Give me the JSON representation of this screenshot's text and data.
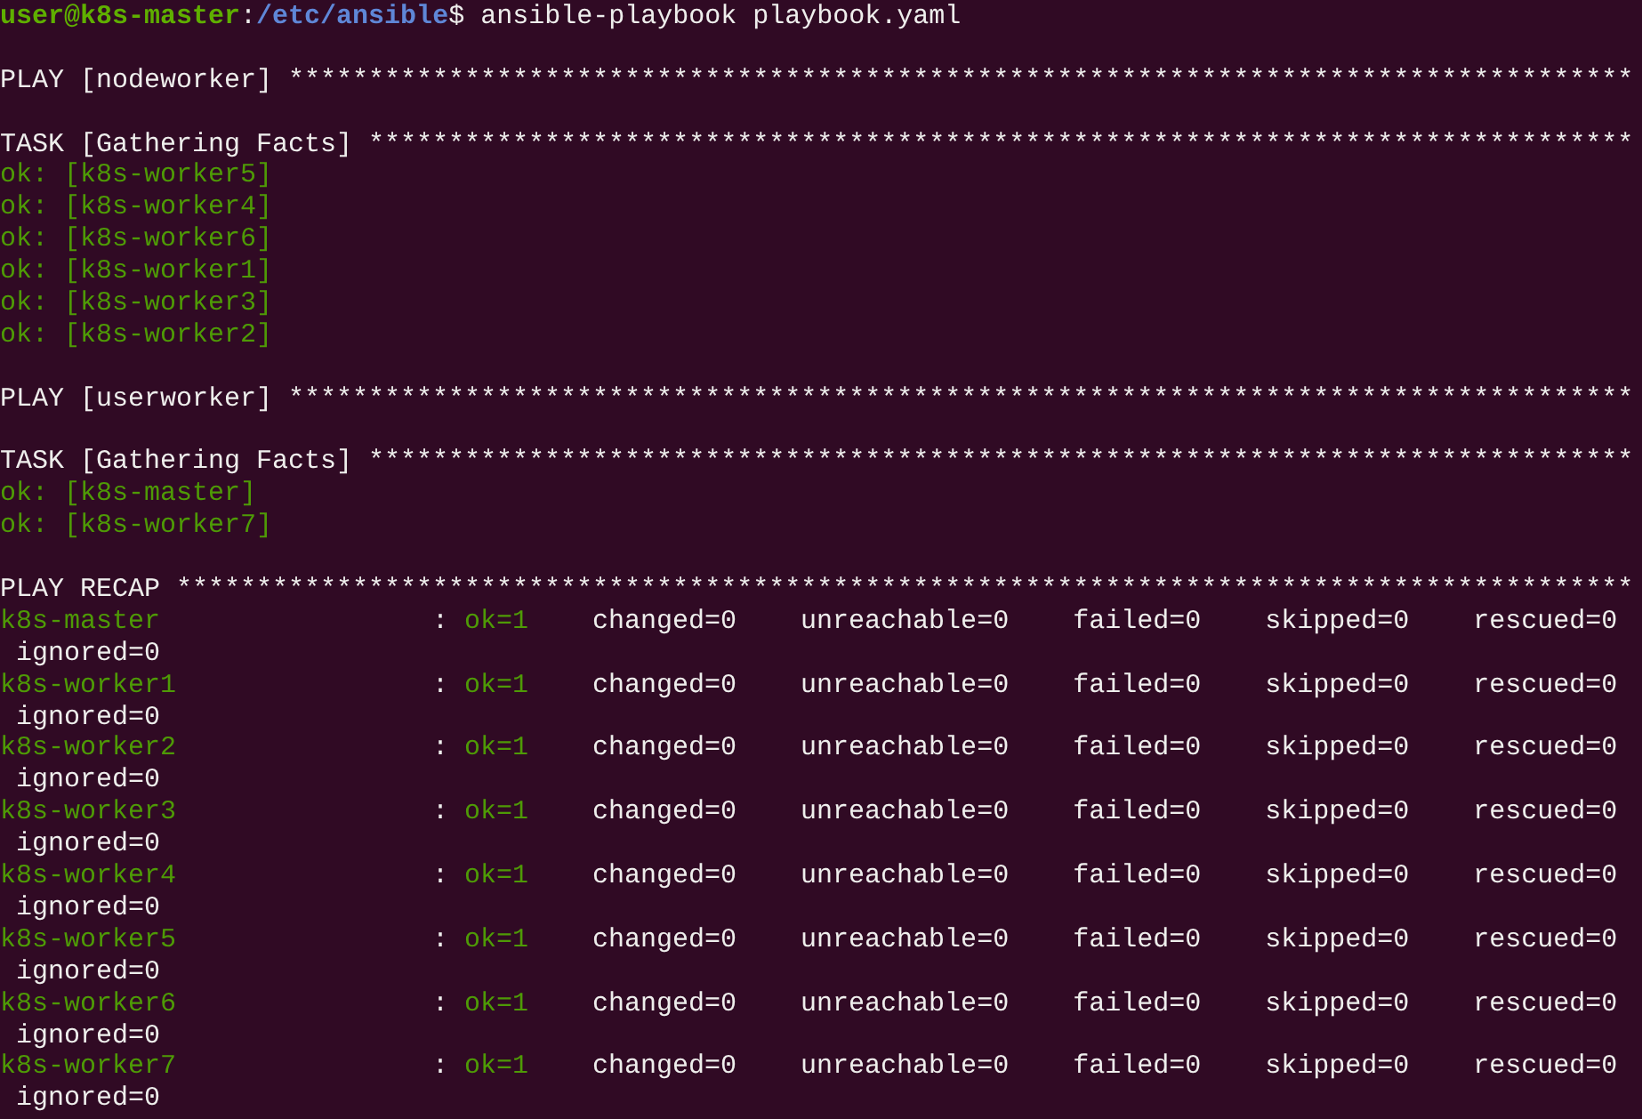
{
  "prompt": {
    "user_host": "user@k8s-master",
    "separator": ":",
    "path": "/etc/ansible",
    "symbol": "$",
    "command": "ansible-playbook playbook.yaml"
  },
  "lines": [
    {
      "kind": "blank"
    },
    {
      "kind": "header",
      "text": "PLAY [nodeworker] ************************************************************************************"
    },
    {
      "kind": "blank"
    },
    {
      "kind": "header",
      "text": "TASK [Gathering Facts] *******************************************************************************"
    },
    {
      "kind": "ok",
      "text": "ok: [k8s-worker5]"
    },
    {
      "kind": "ok",
      "text": "ok: [k8s-worker4]"
    },
    {
      "kind": "ok",
      "text": "ok: [k8s-worker6]"
    },
    {
      "kind": "ok",
      "text": "ok: [k8s-worker1]"
    },
    {
      "kind": "ok",
      "text": "ok: [k8s-worker3]"
    },
    {
      "kind": "ok",
      "text": "ok: [k8s-worker2]"
    },
    {
      "kind": "blank"
    },
    {
      "kind": "header",
      "text": "PLAY [userworker] ************************************************************************************"
    },
    {
      "kind": "blank"
    },
    {
      "kind": "header",
      "text": "TASK [Gathering Facts] *******************************************************************************"
    },
    {
      "kind": "ok",
      "text": "ok: [k8s-master]"
    },
    {
      "kind": "ok",
      "text": "ok: [k8s-worker7]"
    },
    {
      "kind": "blank"
    },
    {
      "kind": "header",
      "text": "PLAY RECAP *******************************************************************************************"
    }
  ],
  "recap": [
    {
      "host": "k8s-master",
      "separator": ":",
      "ok": "ok=1",
      "changed": "changed=0",
      "unreachable": "unreachable=0",
      "failed": "failed=0",
      "skipped": "skipped=0",
      "rescued": "rescued=0",
      "ignored": "ignored=0"
    },
    {
      "host": "k8s-worker1",
      "separator": ":",
      "ok": "ok=1",
      "changed": "changed=0",
      "unreachable": "unreachable=0",
      "failed": "failed=0",
      "skipped": "skipped=0",
      "rescued": "rescued=0",
      "ignored": "ignored=0"
    },
    {
      "host": "k8s-worker2",
      "separator": ":",
      "ok": "ok=1",
      "changed": "changed=0",
      "unreachable": "unreachable=0",
      "failed": "failed=0",
      "skipped": "skipped=0",
      "rescued": "rescued=0",
      "ignored": "ignored=0"
    },
    {
      "host": "k8s-worker3",
      "separator": ":",
      "ok": "ok=1",
      "changed": "changed=0",
      "unreachable": "unreachable=0",
      "failed": "failed=0",
      "skipped": "skipped=0",
      "rescued": "rescued=0",
      "ignored": "ignored=0"
    },
    {
      "host": "k8s-worker4",
      "separator": ":",
      "ok": "ok=1",
      "changed": "changed=0",
      "unreachable": "unreachable=0",
      "failed": "failed=0",
      "skipped": "skipped=0",
      "rescued": "rescued=0",
      "ignored": "ignored=0"
    },
    {
      "host": "k8s-worker5",
      "separator": ":",
      "ok": "ok=1",
      "changed": "changed=0",
      "unreachable": "unreachable=0",
      "failed": "failed=0",
      "skipped": "skipped=0",
      "rescued": "rescued=0",
      "ignored": "ignored=0"
    },
    {
      "host": "k8s-worker6",
      "separator": ":",
      "ok": "ok=1",
      "changed": "changed=0",
      "unreachable": "unreachable=0",
      "failed": "failed=0",
      "skipped": "skipped=0",
      "rescued": "rescued=0",
      "ignored": "ignored=0"
    },
    {
      "host": "k8s-worker7",
      "separator": ":",
      "ok": "ok=1",
      "changed": "changed=0",
      "unreachable": "unreachable=0",
      "failed": "failed=0",
      "skipped": "skipped=0",
      "rescued": "rescued=0",
      "ignored": "ignored=0"
    }
  ]
}
